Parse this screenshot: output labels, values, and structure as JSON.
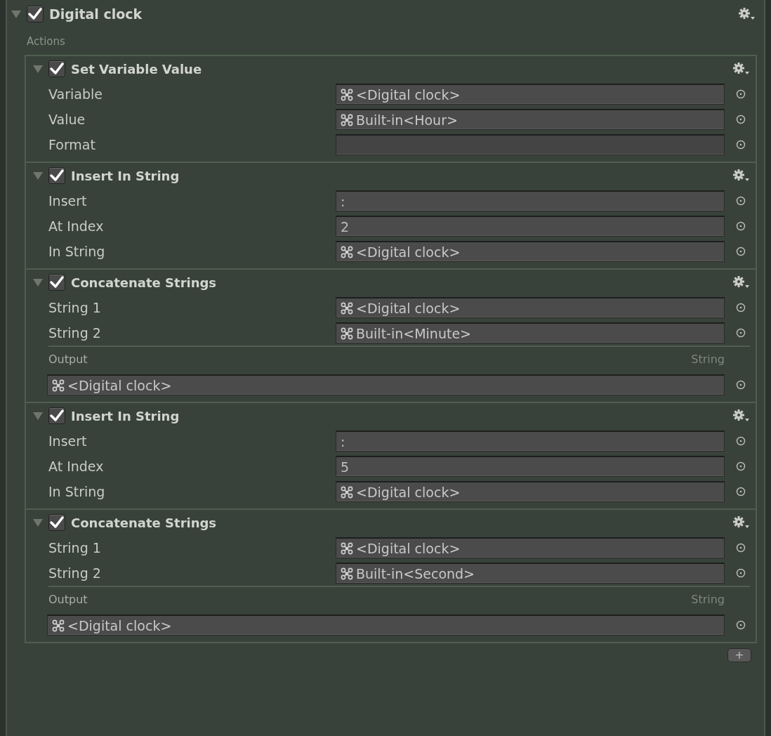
{
  "group": {
    "title": "Digital clock",
    "expanded": true,
    "enabled": true,
    "section_label": "Actions",
    "actions": [
      {
        "title": "Set Variable Value",
        "expanded": true,
        "enabled": true,
        "fields": [
          {
            "label": "Variable",
            "kind": "variable",
            "value": "<Digital clock>"
          },
          {
            "label": "Value",
            "kind": "variable",
            "value": "Built-in<Hour>"
          },
          {
            "label": "Format",
            "kind": "text"
          }
        ]
      },
      {
        "title": "Insert In String",
        "expanded": true,
        "enabled": true,
        "fields": [
          {
            "label": "Insert",
            "kind": "text",
            "value": ":"
          },
          {
            "label": "At Index",
            "kind": "text",
            "value": "2"
          },
          {
            "label": "In String",
            "kind": "variable",
            "value": "<Digital clock>"
          }
        ]
      },
      {
        "title": "Concatenate Strings",
        "expanded": true,
        "enabled": true,
        "fields": [
          {
            "label": "String 1",
            "kind": "variable",
            "value": "<Digital clock>"
          },
          {
            "label": "String 2",
            "kind": "variable",
            "value": "Built-in<Minute>"
          }
        ],
        "output": {
          "label": "Output",
          "type": "String",
          "kind": "variable",
          "value": "<Digital clock>"
        }
      },
      {
        "title": "Insert In String",
        "expanded": true,
        "enabled": true,
        "fields": [
          {
            "label": "Insert",
            "kind": "text",
            "value": ":"
          },
          {
            "label": "At Index",
            "kind": "text",
            "value": "5"
          },
          {
            "label": "In String",
            "kind": "variable",
            "value": "<Digital clock>"
          }
        ]
      },
      {
        "title": "Concatenate Strings",
        "expanded": true,
        "enabled": true,
        "fields": [
          {
            "label": "String 1",
            "kind": "variable",
            "value": "<Digital clock>"
          },
          {
            "label": "String 2",
            "kind": "variable",
            "value": "Built-in<Second>"
          }
        ],
        "output": {
          "label": "Output",
          "type": "String",
          "kind": "variable",
          "value": "<Digital clock>"
        }
      }
    ]
  },
  "add_button": "+"
}
